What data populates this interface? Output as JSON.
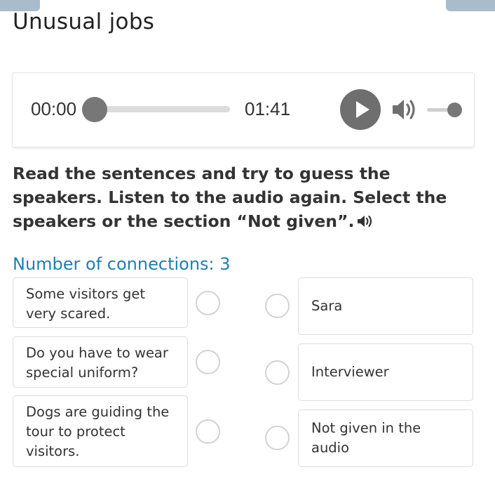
{
  "page": {
    "title": "Unusual jobs"
  },
  "player": {
    "current_time": "00:00",
    "duration": "01:41",
    "progress_fraction": 0,
    "volume_fraction": 1,
    "play_icon": "play-icon",
    "volume_icon": "speaker-icon"
  },
  "task": {
    "instructions": "Read the sentences and try to guess the speakers. Listen to the audio again. Select the speakers or the section “Not given”.",
    "instructions_audio_icon": "speaker-icon",
    "connections_label": "Number of connections: 3"
  },
  "statements": [
    {
      "text": "Some visitors get very scared."
    },
    {
      "text": "Do you have to wear special uniform?"
    },
    {
      "text": "Dogs are guiding the tour to protect visitors."
    }
  ],
  "options": [
    {
      "text": "Sara"
    },
    {
      "text": "Interviewer"
    },
    {
      "text": "Not given in the audio"
    }
  ],
  "colors": {
    "accent": "#1f7fb3",
    "control_gray": "#6f6f6f",
    "border": "#dcdcdc"
  }
}
